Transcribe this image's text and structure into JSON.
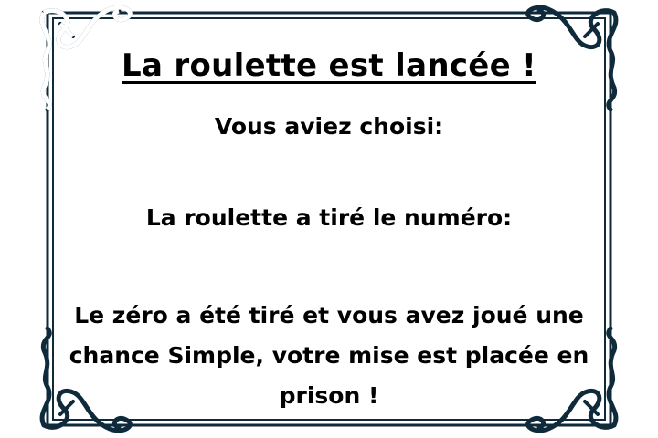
{
  "title": "La roulette est lancée !",
  "chosen_label": "Vous aviez choisi:",
  "drawn_label": "La roulette a tiré le numéro:",
  "result_message": "Le zéro a été tiré et vous avez joué une chance Simple, votre mise est placée en prison !",
  "colors": {
    "frame": "#0f2a3a",
    "text": "#000000"
  }
}
